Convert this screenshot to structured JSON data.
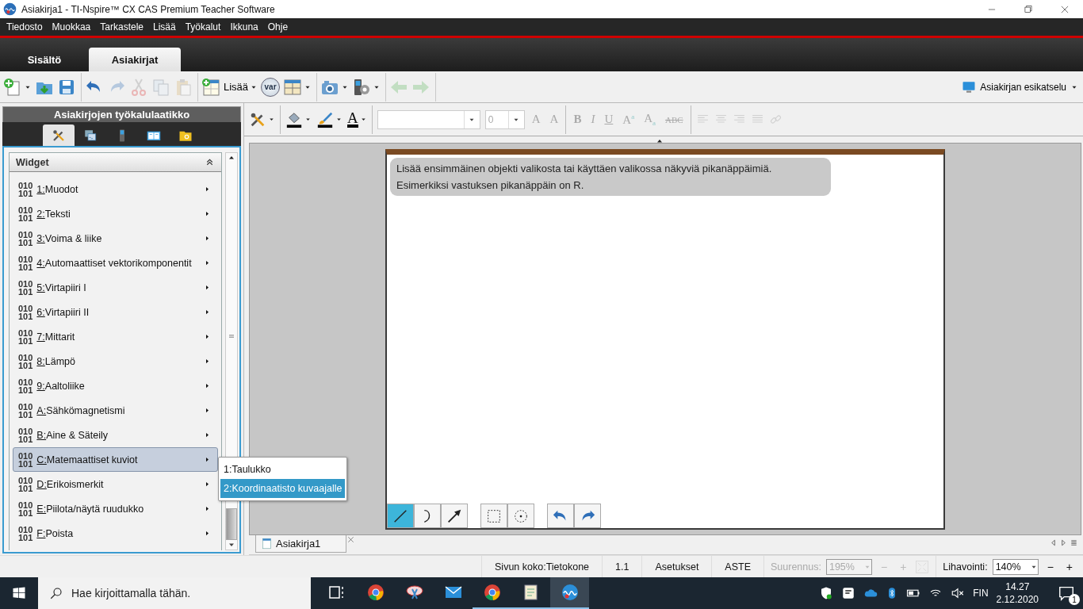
{
  "window": {
    "title": "Asiakirja1 - TI-Nspire™ CX CAS Premium Teacher Software"
  },
  "menu_bar": [
    "Tiedosto",
    "Muokkaa",
    "Tarkastele",
    "Lisää",
    "Työkalut",
    "Ikkuna",
    "Ohje"
  ],
  "tabs": [
    {
      "label": "Sisältö",
      "selected": false
    },
    {
      "label": "Asiakirjat",
      "selected": true
    }
  ],
  "toolbar": {
    "groups": [
      [
        {
          "kind": "new",
          "dropdown": true,
          "disabled": false
        },
        {
          "kind": "open",
          "dropdown": false,
          "disabled": false
        },
        {
          "kind": "save",
          "dropdown": false,
          "disabled": false
        }
      ],
      [
        {
          "kind": "undo",
          "dropdown": false,
          "disabled": false
        },
        {
          "kind": "redo",
          "dropdown": false,
          "disabled": true
        },
        {
          "kind": "cut",
          "dropdown": false,
          "disabled": true
        },
        {
          "kind": "copy",
          "dropdown": false,
          "disabled": true
        },
        {
          "kind": "paste",
          "dropdown": false,
          "disabled": true
        }
      ],
      [
        {
          "kind": "insert",
          "label": "Lisää",
          "dropdown": true,
          "disabled": false
        },
        {
          "kind": "variable",
          "label": "var",
          "dropdown": false,
          "disabled": false
        },
        {
          "kind": "layout",
          "dropdown": true,
          "disabled": false
        }
      ],
      [
        {
          "kind": "capture",
          "dropdown": true,
          "disabled": false
        },
        {
          "kind": "device",
          "dropdown": true,
          "disabled": false
        }
      ],
      [
        {
          "kind": "back",
          "dropdown": false,
          "disabled": true
        },
        {
          "kind": "forward",
          "dropdown": false,
          "disabled": true
        }
      ]
    ],
    "preview": {
      "label": "Asiakirjan esikatselu"
    }
  },
  "toolbox": {
    "title": "Asiakirjojen työkalulaatikko",
    "tabs": [
      {
        "kind": "tools",
        "selected": true
      },
      {
        "kind": "pages",
        "selected": false
      },
      {
        "kind": "handheld",
        "selected": false
      },
      {
        "kind": "book",
        "selected": false
      },
      {
        "kind": "folder",
        "selected": false
      }
    ],
    "section": {
      "title": "Widget",
      "expanded": true
    },
    "items": [
      {
        "code": [
          "010",
          "101"
        ],
        "label": "1:Muodot",
        "selected": false
      },
      {
        "code": [
          "010",
          "101"
        ],
        "label": "2:Teksti",
        "selected": false
      },
      {
        "code": [
          "010",
          "101"
        ],
        "label": "3:Voima & liike",
        "selected": false
      },
      {
        "code": [
          "010",
          "101"
        ],
        "label": "4:Automaattiset vektorikomponentit",
        "selected": false
      },
      {
        "code": [
          "010",
          "101"
        ],
        "label": "5:Virtapiiri I",
        "selected": false
      },
      {
        "code": [
          "010",
          "101"
        ],
        "label": "6:Virtapiiri II",
        "selected": false
      },
      {
        "code": [
          "010",
          "101"
        ],
        "label": "7:Mittarit",
        "selected": false
      },
      {
        "code": [
          "010",
          "101"
        ],
        "label": "8:Lämpö",
        "selected": false
      },
      {
        "code": [
          "010",
          "101"
        ],
        "label": "9:Aaltoliike",
        "selected": false
      },
      {
        "code": [
          "010",
          "101"
        ],
        "label": "A:Sähkömagnetismi",
        "selected": false
      },
      {
        "code": [
          "010",
          "101"
        ],
        "label": "B:Aine & Säteily",
        "selected": false
      },
      {
        "code": [
          "010",
          "101"
        ],
        "label": "C:Matemaattiset kuviot",
        "selected": true
      },
      {
        "code": [
          "010",
          "101"
        ],
        "label": "D:Erikoismerkit",
        "selected": false
      },
      {
        "code": [
          "010",
          "101"
        ],
        "label": "E:Piilota/näytä ruudukko",
        "selected": false
      },
      {
        "code": [
          "010",
          "101"
        ],
        "label": "F:Poista",
        "selected": false
      }
    ],
    "submenu": [
      {
        "label": "1:Taulukko",
        "selected": false
      },
      {
        "label": "2:Koordinaatisto kuvaajalle",
        "selected": true
      }
    ]
  },
  "format_toolbar": {
    "style_tools": [
      {
        "kind": "tools"
      },
      {
        "kind": "fill"
      },
      {
        "kind": "pen"
      },
      {
        "kind": "text_color",
        "label": "A"
      }
    ],
    "font_size": "0",
    "text_buttons": [
      {
        "kind": "grow",
        "label": "A",
        "disabled": true
      },
      {
        "kind": "shrink",
        "label": "A",
        "disabled": true
      },
      {
        "kind": "bold",
        "label": "B",
        "disabled": true
      },
      {
        "kind": "italic",
        "label": "I",
        "disabled": true
      },
      {
        "kind": "underline",
        "label": "U",
        "disabled": true
      },
      {
        "kind": "superscript",
        "label": "A$^{a}$",
        "disabled": true
      },
      {
        "kind": "subscript",
        "label": "A$_{a}$",
        "disabled": true
      },
      {
        "kind": "strike",
        "label": "ABC",
        "disabled": true
      }
    ],
    "align_buttons": [
      {
        "kind": "left",
        "disabled": true
      },
      {
        "kind": "center",
        "disabled": true
      },
      {
        "kind": "right",
        "disabled": true
      },
      {
        "kind": "justify",
        "disabled": true
      },
      {
        "kind": "link",
        "disabled": true
      }
    ]
  },
  "document": {
    "hint": [
      "Lisää ensimmäinen objekti valikosta tai käyttäen valikossa näkyviä pikanäppäimiä.",
      "Esimerkiksi vastuksen pikanäppäin on R."
    ],
    "tool_groups": [
      [
        {
          "kind": "line",
          "selected": true
        },
        {
          "kind": "arc",
          "selected": false
        },
        {
          "kind": "arrow",
          "selected": false
        }
      ],
      [
        {
          "kind": "select",
          "selected": false
        },
        {
          "kind": "point",
          "selected": false
        }
      ],
      [
        {
          "kind": "undo",
          "selected": false
        },
        {
          "kind": "redo",
          "selected": false
        }
      ]
    ]
  },
  "doc_tabs": [
    {
      "label": "Asiakirja1",
      "selected": true
    }
  ],
  "status_bar": {
    "page_size": "Sivun koko:Tietokone",
    "page": "1.1",
    "settings": "Asetukset",
    "angle": "ASTE",
    "zoom": {
      "label": "Suurennus:",
      "value": "195%",
      "disabled": true,
      "minus": "−",
      "plus": "+"
    },
    "pinch": {
      "label": "Lihavointi:",
      "value": "140%",
      "disabled": false,
      "minus": "−",
      "plus": "+"
    }
  },
  "taskbar": {
    "search_placeholder": "Hae kirjoittamalla tähän.",
    "apps": [
      {
        "kind": "taskview",
        "running": false,
        "active": false
      },
      {
        "kind": "chrome",
        "running": false,
        "active": false
      },
      {
        "kind": "snip",
        "running": false,
        "active": false
      },
      {
        "kind": "mail",
        "running": false,
        "active": false
      },
      {
        "kind": "chrome",
        "running": true,
        "active": false
      },
      {
        "kind": "notes",
        "running": true,
        "active": false
      },
      {
        "kind": "nspire",
        "running": true,
        "active": true
      }
    ],
    "language": "FIN",
    "time": "14.27",
    "date": "2.12.2020",
    "notifications": "1"
  }
}
